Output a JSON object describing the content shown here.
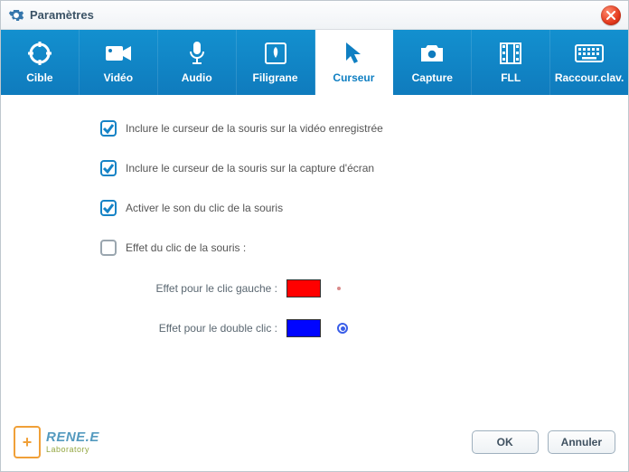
{
  "window": {
    "title": "Paramètres"
  },
  "tabs": [
    {
      "key": "cible",
      "label": "Cible",
      "icon": "target-icon",
      "active": false
    },
    {
      "key": "video",
      "label": "Vidéo",
      "icon": "camera-icon",
      "active": false
    },
    {
      "key": "audio",
      "label": "Audio",
      "icon": "microphone-icon",
      "active": false
    },
    {
      "key": "filigrane",
      "label": "Filigrane",
      "icon": "watermark-icon",
      "active": false
    },
    {
      "key": "curseur",
      "label": "Curseur",
      "icon": "cursor-icon",
      "active": true
    },
    {
      "key": "capture",
      "label": "Capture",
      "icon": "photo-icon",
      "active": false
    },
    {
      "key": "fll",
      "label": "FLL",
      "icon": "filmstrip-icon",
      "active": false
    },
    {
      "key": "raccourci",
      "label": "Raccour.clav.",
      "icon": "keyboard-icon",
      "active": false
    }
  ],
  "cursor": {
    "include_video": {
      "label": "Inclure le curseur de la souris sur la vidéo enregistrée",
      "checked": true
    },
    "include_capture": {
      "label": "Inclure le curseur de la souris sur la capture d'écran",
      "checked": true
    },
    "click_sound": {
      "label": "Activer le son du clic de la souris",
      "checked": true
    },
    "click_effect": {
      "label": "Effet du clic de la souris :",
      "checked": false
    },
    "left_click": {
      "label": "Effet pour le clic gauche :",
      "color": "#ff0000"
    },
    "double_click": {
      "label": "Effet pour le double clic :",
      "color": "#0005ff"
    }
  },
  "footer": {
    "brand": "RENE.E",
    "sub": "Laboratory",
    "ok": "OK",
    "cancel": "Annuler"
  }
}
